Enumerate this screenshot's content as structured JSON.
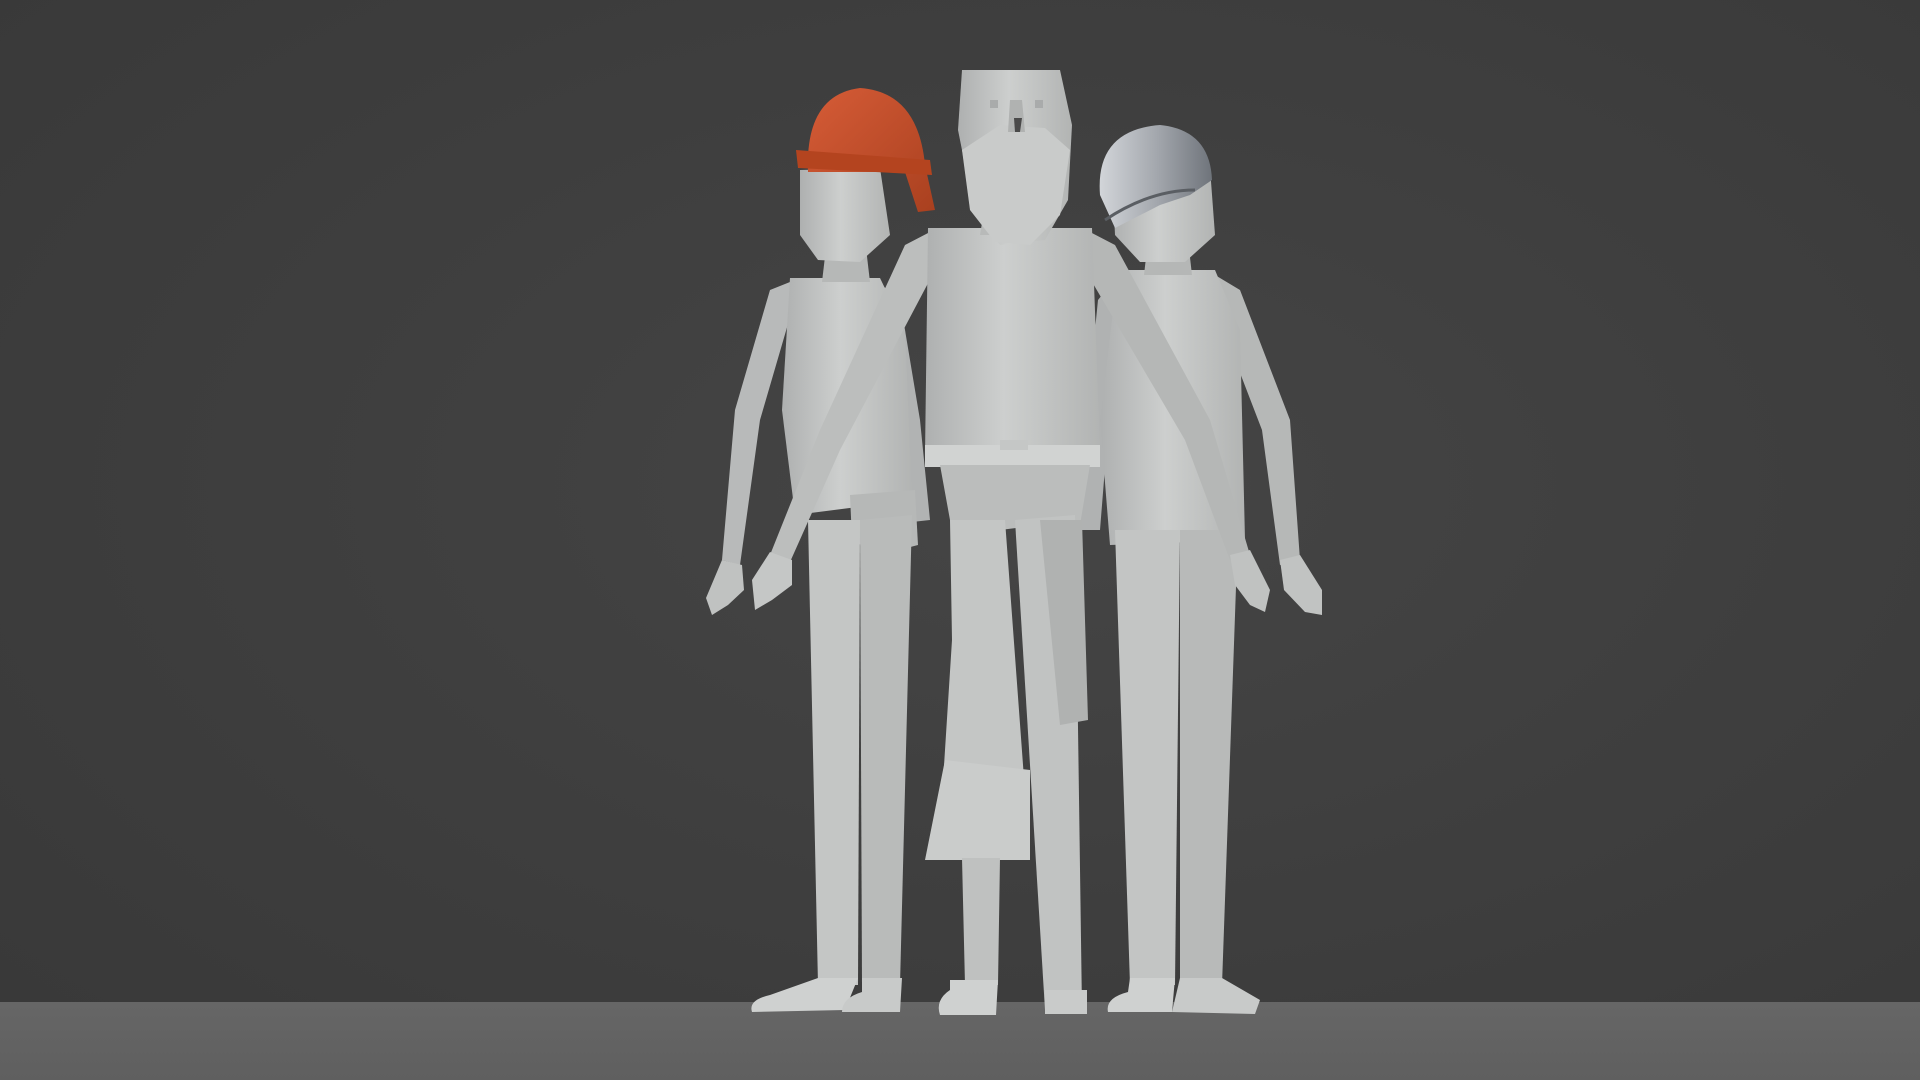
{
  "scene": {
    "background_color": "#3d3d3d",
    "floor_color": "#636363",
    "model_color": "#c3c5c4",
    "hard_hat_color": "#c8502e",
    "helmet_color": "#9ea3aa"
  },
  "figures": [
    {
      "id": "left",
      "headwear": "hard-hat"
    },
    {
      "id": "center",
      "headwear": "none"
    },
    {
      "id": "right",
      "headwear": "helmet"
    }
  ]
}
